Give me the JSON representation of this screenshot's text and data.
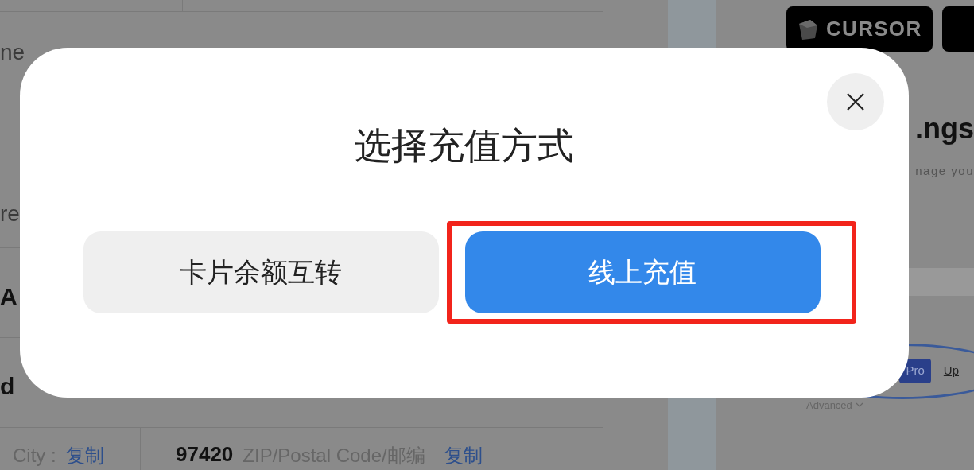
{
  "background": {
    "left_rows": [
      {
        "text": "ne",
        "kind": "label"
      },
      {
        "kind": "empty"
      },
      {
        "text": "re",
        "kind": "label"
      },
      {
        "text": "A",
        "kind": "value"
      },
      {
        "text": "d",
        "kind": "value"
      }
    ],
    "address_row": {
      "city_label": "City :",
      "city_copy": "复制",
      "zip_value": "97420",
      "zip_label": "ZIP/Postal Code/邮编",
      "zip_copy": "复制"
    },
    "right": {
      "logo": "CURSOR",
      "heading": ".ngs",
      "subtitle": "nage you",
      "plan_badge": "Pro",
      "upgrade_link": "Up",
      "advanced": "Advanced"
    }
  },
  "dialog": {
    "title": "选择充值方式",
    "buttons": [
      {
        "label": "卡片余额互转",
        "kind": "secondary",
        "highlighted": false
      },
      {
        "label": "线上充值",
        "kind": "primary",
        "highlighted": true
      }
    ]
  }
}
